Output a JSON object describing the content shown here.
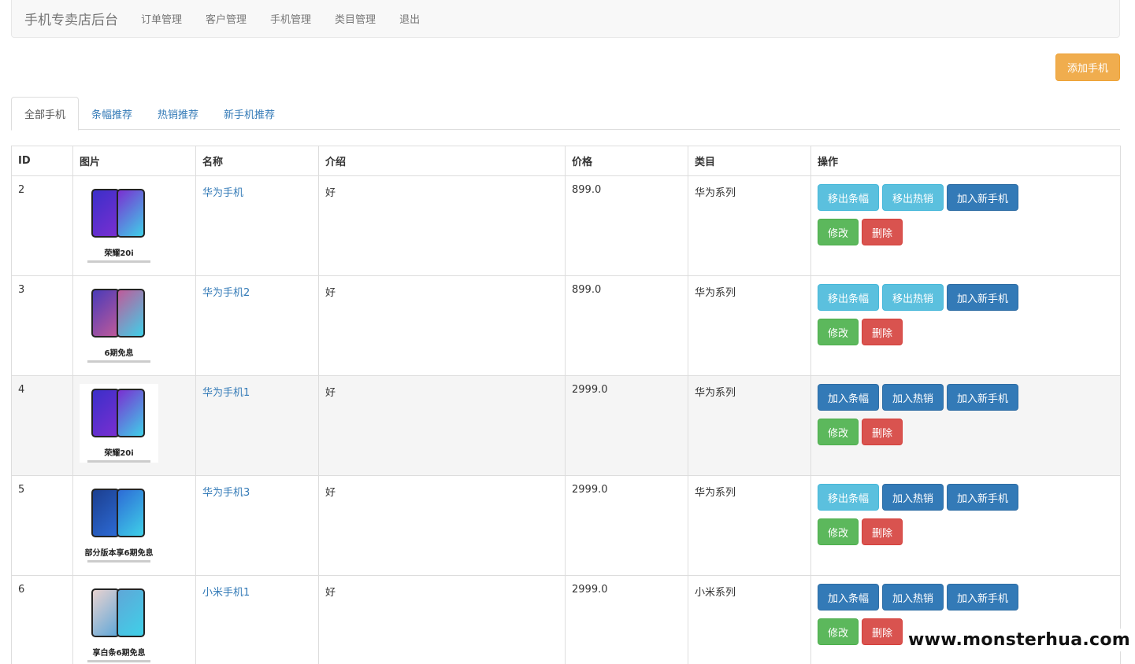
{
  "navbar": {
    "brand": "手机专卖店后台",
    "links": [
      "订单管理",
      "客户管理",
      "手机管理",
      "类目管理",
      "退出"
    ]
  },
  "add_button": "添加手机",
  "tabs": [
    "全部手机",
    "条幅推荐",
    "热销推荐",
    "新手机推荐"
  ],
  "table": {
    "headers": [
      "ID",
      "图片",
      "名称",
      "介绍",
      "价格",
      "类目",
      "操作"
    ],
    "rows": [
      {
        "id": "2",
        "image_caption": "荣耀20i",
        "name": "华为手机",
        "intro": "好",
        "price": "899.0",
        "category": "华为系列",
        "ops": [
          "移出条幅",
          "移出热销",
          "加入新手机"
        ],
        "op_styles": [
          "info",
          "info",
          "primary"
        ]
      },
      {
        "id": "3",
        "image_caption": "6期免息",
        "name": "华为手机2",
        "intro": "好",
        "price": "899.0",
        "category": "华为系列",
        "ops": [
          "移出条幅",
          "移出热销",
          "加入新手机"
        ],
        "op_styles": [
          "info",
          "info",
          "primary"
        ]
      },
      {
        "id": "4",
        "image_caption": "荣耀20i",
        "name": "华为手机1",
        "intro": "好",
        "price": "2999.0",
        "category": "华为系列",
        "ops": [
          "加入条幅",
          "加入热销",
          "加入新手机"
        ],
        "op_styles": [
          "primary",
          "primary",
          "primary"
        ]
      },
      {
        "id": "5",
        "image_caption": "部分版本享6期免息",
        "name": "华为手机3",
        "intro": "好",
        "price": "2999.0",
        "category": "华为系列",
        "ops": [
          "移出条幅",
          "加入热销",
          "加入新手机"
        ],
        "op_styles": [
          "info",
          "primary",
          "primary"
        ]
      },
      {
        "id": "6",
        "image_caption": "享白条6期免息",
        "name": "小米手机1",
        "intro": "好",
        "price": "2999.0",
        "category": "小米系列",
        "ops": [
          "加入条幅",
          "加入热销",
          "加入新手机"
        ],
        "op_styles": [
          "primary",
          "primary",
          "primary"
        ]
      }
    ],
    "edit_label": "修改",
    "delete_label": "删除"
  },
  "watermark": "www.monsterhua.com"
}
